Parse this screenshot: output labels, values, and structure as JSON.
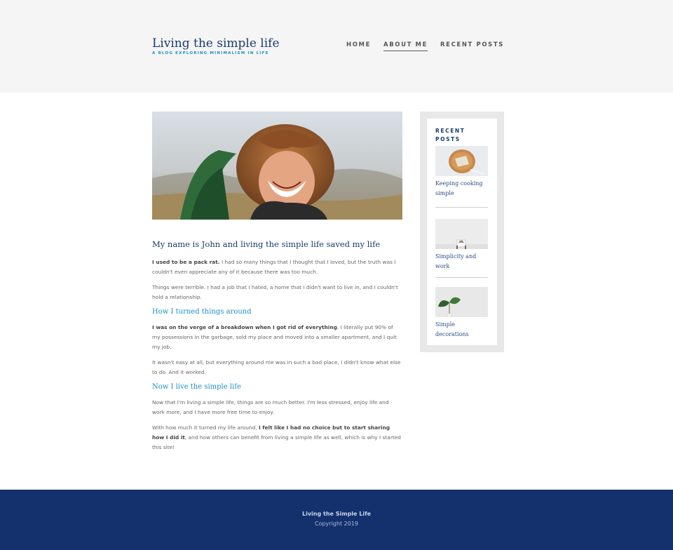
{
  "site": {
    "title": "Living the simple life",
    "subtitle": "A BLOG EXPLORING MINIMALISM IN LIFE"
  },
  "nav": {
    "items": [
      {
        "label": "HOME"
      },
      {
        "label": "ABOUT ME",
        "active": true
      },
      {
        "label": "RECENT POSTS"
      }
    ]
  },
  "article": {
    "heading": "My name is John and living the simple life saved my life",
    "p1_bold": "I used to be a pack rat.",
    "p1_rest": " I had so many things that I thought that I loved, but the truth was I couldn't even appreciate any of it because there was too much.",
    "p2": "Things were terrible. I had a job that I hated, a home that I didn't want to live in, and I couldn't hold a relationship.",
    "h2": "How I turned things around",
    "p3_bold": "I was on the verge of a breakdown when I got rid of everything",
    "p3_rest": ". I literally put 90% of my possessions in the garbage, sold my place and moved into a smaller apartment, and I quit my job.",
    "p4": "It wasn't easy at all, but everything around me was in such a bad place, I didn't know what else to do. And it worked.",
    "h3": "Now I live the simple life",
    "p5": "Now that I'm living a simple life, things are so much better. I'm less stressed, enjoy life and work more, and I have more free time to enjoy.",
    "p6_start": "With how much it turned my life around, ",
    "p6_bold": "I felt like I had no choice but to start sharing how I did it",
    "p6_rest": ", and how others can benefit from living a simple life as well, which is why I started this site!"
  },
  "sidebar": {
    "title": "RECENT POSTS",
    "posts": [
      {
        "title": "Keeping cooking simple",
        "icon": "food-plate-thumbnail"
      },
      {
        "title": "Simplicity and work",
        "icon": "desk-chair-thumbnail"
      },
      {
        "title": "Simple decorations",
        "icon": "plant-thumbnail"
      }
    ]
  },
  "footer": {
    "title": "Living the Simple Life",
    "copyright": "Copyright 2019"
  },
  "colors": {
    "brand_navy": "#1a3a6e",
    "accent_blue": "#1d8fc4",
    "footer_bg": "#14316e",
    "header_bg": "#f5f5f5"
  }
}
